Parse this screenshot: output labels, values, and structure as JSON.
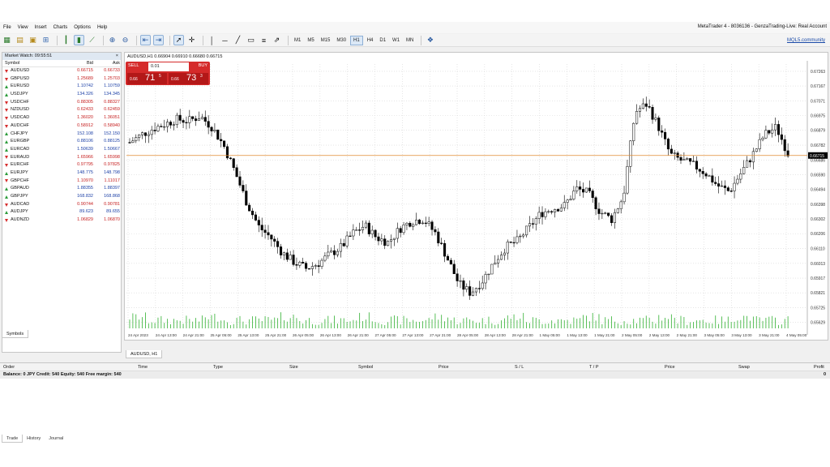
{
  "menu": [
    "File",
    "View",
    "Insert",
    "Charts",
    "Options",
    "Help"
  ],
  "window_title": "MetaTrader 4 - 8036136 - GenzaTrading-Live: Real Account",
  "toolbar": {
    "timeframes": [
      "M1",
      "M5",
      "M15",
      "M30",
      "H1",
      "H4",
      "D1",
      "W1",
      "MN"
    ],
    "active_timeframe": "H1",
    "community_link": "MQL5.community"
  },
  "market_watch": {
    "title": "Market Watch: 09:55:51",
    "col_symbol": "Symbol",
    "col_bid": "Bid",
    "col_ask": "Ask",
    "rows": [
      {
        "symbol": "AUDUSD",
        "bid": "0.66715",
        "ask": "0.66733",
        "dir": "down"
      },
      {
        "symbol": "GBPUSD",
        "bid": "1.25689",
        "ask": "1.25703",
        "dir": "down"
      },
      {
        "symbol": "EURUSD",
        "bid": "1.10742",
        "ask": "1.10759",
        "dir": "up"
      },
      {
        "symbol": "USDJPY",
        "bid": "134.326",
        "ask": "134.345",
        "dir": "up"
      },
      {
        "symbol": "USDCHF",
        "bid": "0.88305",
        "ask": "0.88327",
        "dir": "down"
      },
      {
        "symbol": "NZDUSD",
        "bid": "0.62433",
        "ask": "0.62459",
        "dir": "down"
      },
      {
        "symbol": "USDCAD",
        "bid": "1.36020",
        "ask": "1.36051",
        "dir": "down"
      },
      {
        "symbol": "AUDCHF",
        "bid": "0.58912",
        "ask": "0.58940",
        "dir": "down"
      },
      {
        "symbol": "CHFJPY",
        "bid": "152.108",
        "ask": "152.150",
        "dir": "up"
      },
      {
        "symbol": "EURGBP",
        "bid": "0.88106",
        "ask": "0.88125",
        "dir": "up"
      },
      {
        "symbol": "EURCAD",
        "bid": "1.50639",
        "ask": "1.50667",
        "dir": "up"
      },
      {
        "symbol": "EURAUD",
        "bid": "1.65966",
        "ask": "1.65998",
        "dir": "down"
      },
      {
        "symbol": "EURCHF",
        "bid": "0.97795",
        "ask": "0.97825",
        "dir": "down"
      },
      {
        "symbol": "EURJPY",
        "bid": "148.775",
        "ask": "148.798",
        "dir": "up"
      },
      {
        "symbol": "GBPCHF",
        "bid": "1.10970",
        "ask": "1.11017",
        "dir": "down"
      },
      {
        "symbol": "GBPAUD",
        "bid": "1.88355",
        "ask": "1.88397",
        "dir": "up"
      },
      {
        "symbol": "GBPJPY",
        "bid": "168.832",
        "ask": "168.868",
        "dir": "up"
      },
      {
        "symbol": "AUDCAD",
        "bid": "0.90744",
        "ask": "0.90781",
        "dir": "down"
      },
      {
        "symbol": "AUDJPY",
        "bid": "89.623",
        "ask": "89.655",
        "dir": "up"
      },
      {
        "symbol": "AUDNZD",
        "bid": "1.06829",
        "ask": "1.06870",
        "dir": "down"
      }
    ],
    "tab": "Symbols"
  },
  "chart": {
    "info": "AUDUSD,H1  0.66904 0.66910 0.66680 0.66715",
    "tab": "AUDUSD, H1",
    "trade_panel": {
      "sell": "SELL",
      "buy": "BUY",
      "lot": "0.01",
      "sell_small": "0.66",
      "sell_big": "71",
      "sell_sup": "5",
      "buy_small": "0.66",
      "buy_big": "73",
      "buy_sup": "3"
    }
  },
  "chart_data": {
    "type": "candlestick",
    "symbol": "AUDUSD",
    "timeframe": "H1",
    "y_ticks": [
      "0.67263",
      "0.67167",
      "0.67071",
      "0.66975",
      "0.66879",
      "0.66782",
      "0.66686",
      "0.66590",
      "0.66494",
      "0.66398",
      "0.66302",
      "0.66206",
      "0.66110",
      "0.66013",
      "0.65917",
      "0.65821",
      "0.65725",
      "0.65629"
    ],
    "ylim": [
      0.6559,
      0.6731
    ],
    "x_ticks": [
      "24 Apr 2023",
      "24 Apr 13:00",
      "24 Apr 21:00",
      "25 Apr 05:00",
      "25 Apr 13:00",
      "25 Apr 21:00",
      "26 Apr 05:00",
      "26 Apr 13:00",
      "26 Apr 21:00",
      "27 Apr 05:00",
      "27 Apr 13:00",
      "27 Apr 21:00",
      "28 Apr 05:00",
      "28 Apr 13:00",
      "28 Apr 21:00",
      "1 May 05:00",
      "1 May 13:00",
      "1 May 21:00",
      "2 May 05:00",
      "2 May 13:00",
      "2 May 21:00",
      "3 May 05:00",
      "3 May 13:00",
      "3 May 21:00",
      "4 May 05:00"
    ],
    "current_price": "0.66715",
    "close_trend": [
      0.668,
      0.6685,
      0.6689,
      0.6692,
      0.6695,
      0.6694,
      0.6697,
      0.669,
      0.6678,
      0.666,
      0.664,
      0.6625,
      0.6618,
      0.6608,
      0.6602,
      0.6598,
      0.6601,
      0.6607,
      0.6612,
      0.6621,
      0.6626,
      0.6618,
      0.6615,
      0.6624,
      0.6629,
      0.663,
      0.6621,
      0.6605,
      0.6588,
      0.6582,
      0.659,
      0.6602,
      0.6612,
      0.6616,
      0.6625,
      0.6634,
      0.6637,
      0.6639,
      0.665,
      0.6647,
      0.6635,
      0.663,
      0.6645,
      0.67,
      0.6705,
      0.669,
      0.6672,
      0.6668,
      0.6665,
      0.666,
      0.6652,
      0.6648,
      0.666,
      0.6672,
      0.6685,
      0.669,
      0.6673
    ]
  },
  "terminal": {
    "columns": [
      "Order",
      "Time",
      "Type",
      "Size",
      "Symbol",
      "Price",
      "S / L",
      "T / P",
      "Price",
      "Swap",
      "Profit"
    ],
    "balance_text": "Balance: 0 JPY  Credit: 540  Equity: 540  Free margin: 540",
    "profit_total": "0",
    "tabs": [
      "Trade",
      "History",
      "Journal"
    ]
  }
}
